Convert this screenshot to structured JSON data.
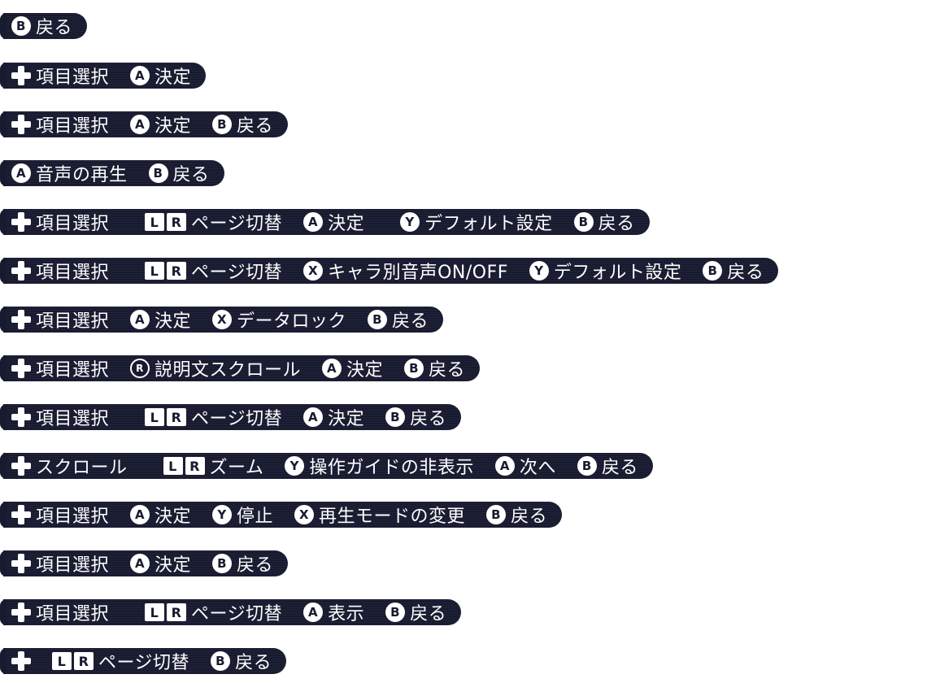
{
  "rows": [
    {
      "items": [
        {
          "icon": "B",
          "label": "戻る"
        }
      ]
    },
    {
      "items": [
        {
          "icon": "dpad",
          "label": "項目選択"
        },
        {
          "icon": "A",
          "label": "決定"
        }
      ]
    },
    {
      "items": [
        {
          "icon": "dpad",
          "label": "項目選択"
        },
        {
          "icon": "A",
          "label": "決定"
        },
        {
          "icon": "B",
          "label": "戻る"
        }
      ]
    },
    {
      "items": [
        {
          "icon": "A",
          "label": "音声の再生"
        },
        {
          "icon": "B",
          "label": "戻る"
        }
      ]
    },
    {
      "items": [
        {
          "icon": "dpad",
          "label": "項目選択",
          "wide": true
        },
        {
          "icon": "LR",
          "label": "ページ切替"
        },
        {
          "icon": "A",
          "label": "決定",
          "wide": true
        },
        {
          "icon": "Y",
          "label": "デフォルト設定"
        },
        {
          "icon": "B",
          "label": "戻る"
        }
      ]
    },
    {
      "items": [
        {
          "icon": "dpad",
          "label": "項目選択",
          "wide": true
        },
        {
          "icon": "LR",
          "label": "ページ切替"
        },
        {
          "icon": "X",
          "label": "キャラ別音声ON/OFF"
        },
        {
          "icon": "Y",
          "label": "デフォルト設定"
        },
        {
          "icon": "B",
          "label": "戻る"
        }
      ]
    },
    {
      "items": [
        {
          "icon": "dpad",
          "label": "項目選択"
        },
        {
          "icon": "A",
          "label": "決定"
        },
        {
          "icon": "X",
          "label": "データロック"
        },
        {
          "icon": "B",
          "label": "戻る"
        }
      ]
    },
    {
      "items": [
        {
          "icon": "dpad",
          "label": "項目選択"
        },
        {
          "icon": "R",
          "label": "説明文スクロール"
        },
        {
          "icon": "A",
          "label": "決定"
        },
        {
          "icon": "B",
          "label": "戻る"
        }
      ]
    },
    {
      "items": [
        {
          "icon": "dpad",
          "label": "項目選択",
          "wide": true
        },
        {
          "icon": "LR",
          "label": "ページ切替"
        },
        {
          "icon": "A",
          "label": "決定"
        },
        {
          "icon": "B",
          "label": "戻る"
        }
      ]
    },
    {
      "items": [
        {
          "icon": "dpad",
          "label": "スクロール",
          "wide": true
        },
        {
          "icon": "LR",
          "label": "ズーム"
        },
        {
          "icon": "Y",
          "label": "操作ガイドの非表示"
        },
        {
          "icon": "A",
          "label": "次へ"
        },
        {
          "icon": "B",
          "label": "戻る"
        }
      ]
    },
    {
      "items": [
        {
          "icon": "dpad",
          "label": "項目選択"
        },
        {
          "icon": "A",
          "label": "決定"
        },
        {
          "icon": "Y",
          "label": "停止"
        },
        {
          "icon": "X",
          "label": "再生モードの変更"
        },
        {
          "icon": "B",
          "label": "戻る"
        }
      ]
    },
    {
      "items": [
        {
          "icon": "dpad",
          "label": "項目選択"
        },
        {
          "icon": "A",
          "label": "決定"
        },
        {
          "icon": "B",
          "label": "戻る"
        }
      ]
    },
    {
      "items": [
        {
          "icon": "dpad",
          "label": "項目選択",
          "wide": true
        },
        {
          "icon": "LR",
          "label": "ページ切替"
        },
        {
          "icon": "A",
          "label": "表示"
        },
        {
          "icon": "B",
          "label": "戻る"
        }
      ]
    },
    {
      "items": [
        {
          "icon": "dpad",
          "label": ""
        },
        {
          "icon": "LR",
          "label": "ページ切替"
        },
        {
          "icon": "B",
          "label": "戻る"
        }
      ]
    }
  ],
  "keys": {
    "L": "L",
    "R": "R"
  }
}
